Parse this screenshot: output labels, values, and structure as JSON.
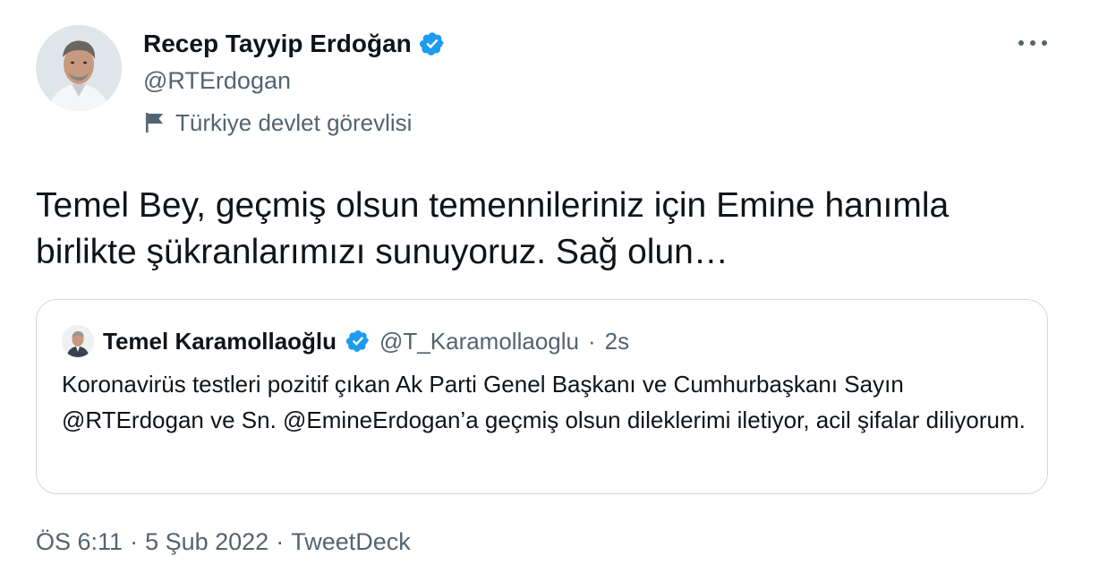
{
  "author": {
    "display_name": "Recep Tayyip Erdoğan",
    "handle": "@RTErdogan",
    "label": "Türkiye devlet görevlisi"
  },
  "tweet": {
    "text": "Temel Bey, geçmiş olsun temennileriniz için Emine hanımla birlikte şükranlarımızı sunuyoruz. Sağ olun…"
  },
  "quoted": {
    "display_name": "Temel Karamollaoğlu",
    "handle": "@T_Karamollaoglu",
    "separator": "·",
    "time": "2s",
    "text": "Koronavirüs testleri pozitif çıkan Ak Parti Genel Başkanı ve Cumhurbaşkanı Sayın @RTErdogan ve Sn. @EmineErdogan’a geçmiş olsun dileklerimi iletiyor, acil şifalar diliyorum."
  },
  "meta": {
    "time": "ÖS 6:11",
    "sep1": "·",
    "date": "5 Şub 2022",
    "sep2": "·",
    "source": "TweetDeck"
  },
  "icons": {
    "verified": "verified-badge-icon",
    "flag": "flag-icon",
    "more": "more-options-icon"
  },
  "colors": {
    "verified": "#1d9bf0",
    "secondary_text": "#536471",
    "border": "#cfd9de"
  }
}
